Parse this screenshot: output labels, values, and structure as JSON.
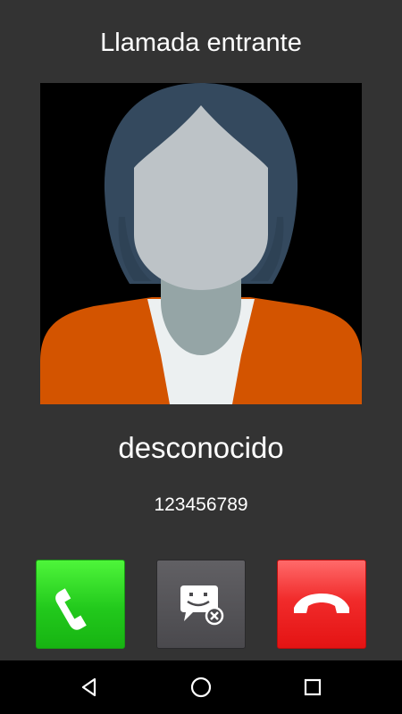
{
  "screen": {
    "title": "Llamada entrante"
  },
  "caller": {
    "name": "desconocido",
    "number": "123456789",
    "avatar_icon": "default-female-avatar-icon"
  },
  "actions": {
    "answer": {
      "icon": "phone-answer-icon",
      "color": "#22c91c"
    },
    "message": {
      "icon": "reject-with-message-icon",
      "color": "#4a494d"
    },
    "reject": {
      "icon": "phone-hangup-icon",
      "color": "#e41313"
    }
  },
  "navbar": {
    "back_icon": "back-triangle-icon",
    "home_icon": "home-circle-icon",
    "recents_icon": "recents-square-icon"
  },
  "colors": {
    "background": "#333333",
    "navbar": "#000000",
    "avatar_hair": "#34495e",
    "avatar_face": "#bdc3c7",
    "avatar_neck": "#95a5a6",
    "avatar_shirt": "#d35400",
    "avatar_undershirt": "#ecf0f1"
  }
}
